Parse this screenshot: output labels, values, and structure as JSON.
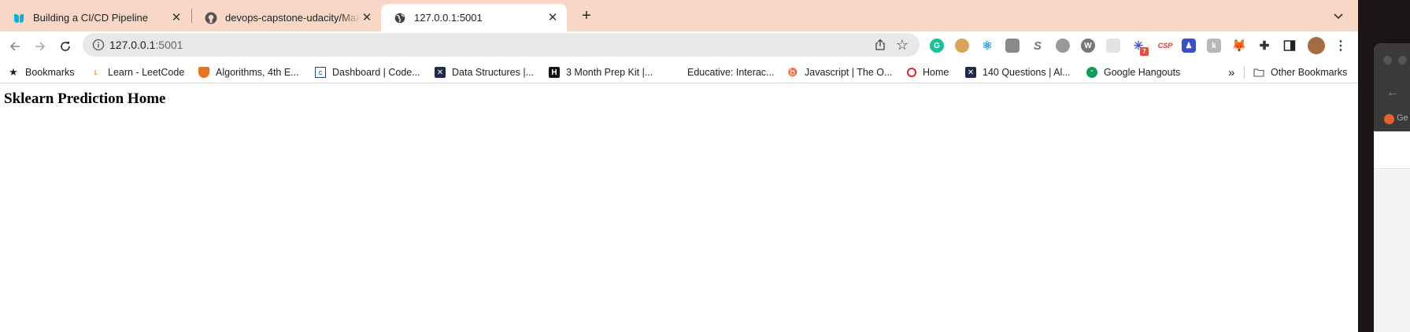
{
  "tabs": [
    {
      "title": "Building a CI/CD Pipeline",
      "icon": "udacity-icon"
    },
    {
      "title": "devops-capstone-udacity/Makefile",
      "icon": "github-icon"
    },
    {
      "title": "127.0.0.1:5001",
      "icon": "globe-icon",
      "active": true
    }
  ],
  "toolbar": {
    "url_host": "127.0.0.1",
    "url_port": ":5001"
  },
  "extensions": {
    "csp_label": "CSP",
    "badge_count": "7"
  },
  "bookmarks": {
    "items": [
      {
        "label": "Bookmarks"
      },
      {
        "label": "Learn - LeetCode"
      },
      {
        "label": "Algorithms, 4th E..."
      },
      {
        "label": "Dashboard | Code..."
      },
      {
        "label": "Data Structures |..."
      },
      {
        "label": "3 Month Prep Kit |..."
      },
      {
        "label": "Educative: Interac..."
      },
      {
        "label": "Javascript | The O..."
      },
      {
        "label": "Home"
      },
      {
        "label": "140 Questions | Al..."
      },
      {
        "label": "Google Hangouts"
      }
    ],
    "overflow": "»",
    "other": "Other Bookmarks"
  },
  "page": {
    "heading": "Sklearn Prediction Home"
  },
  "second_window": {
    "tab_text": "Ge"
  },
  "colors": {
    "tabstrip": "#f8d7c6",
    "omnibox": "#e8e8e8",
    "desktop": "#1a1414"
  }
}
